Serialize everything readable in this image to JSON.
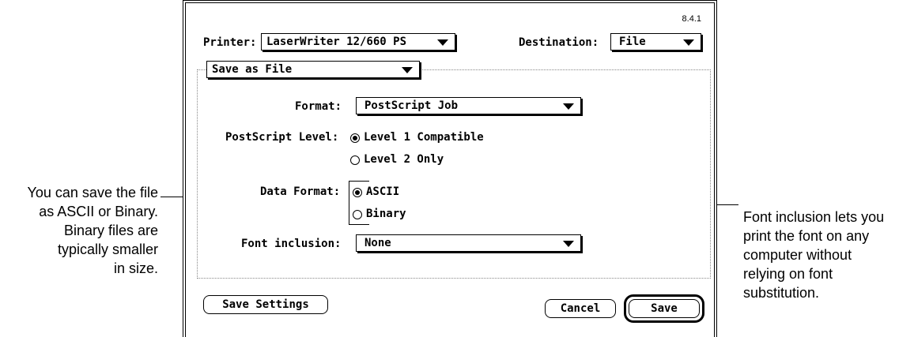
{
  "version": "8.4.1",
  "printer": {
    "label": "Printer:",
    "value": "LaserWriter 12/660 PS"
  },
  "destination": {
    "label": "Destination:",
    "value": "File"
  },
  "panel_menu": {
    "value": "Save as File"
  },
  "format": {
    "label": "Format:",
    "value": "PostScript Job"
  },
  "postscript_level": {
    "label": "PostScript Level:",
    "options": [
      {
        "label": "Level 1 Compatible",
        "selected": true
      },
      {
        "label": "Level 2 Only",
        "selected": false
      }
    ]
  },
  "data_format": {
    "label": "Data Format:",
    "options": [
      {
        "label": "ASCII",
        "selected": true
      },
      {
        "label": "Binary",
        "selected": false
      }
    ]
  },
  "font_inclusion": {
    "label": "Font inclusion:",
    "value": "None"
  },
  "buttons": {
    "save_settings": "Save Settings",
    "cancel": "Cancel",
    "save": "Save"
  },
  "callouts": {
    "left": [
      "You can save the file",
      "as ASCII or Binary.",
      "Binary files are",
      "typically smaller",
      "in size."
    ],
    "right": [
      "Font inclusion lets you",
      "print the font on any",
      "computer without",
      "relying on font",
      "substitution."
    ]
  }
}
